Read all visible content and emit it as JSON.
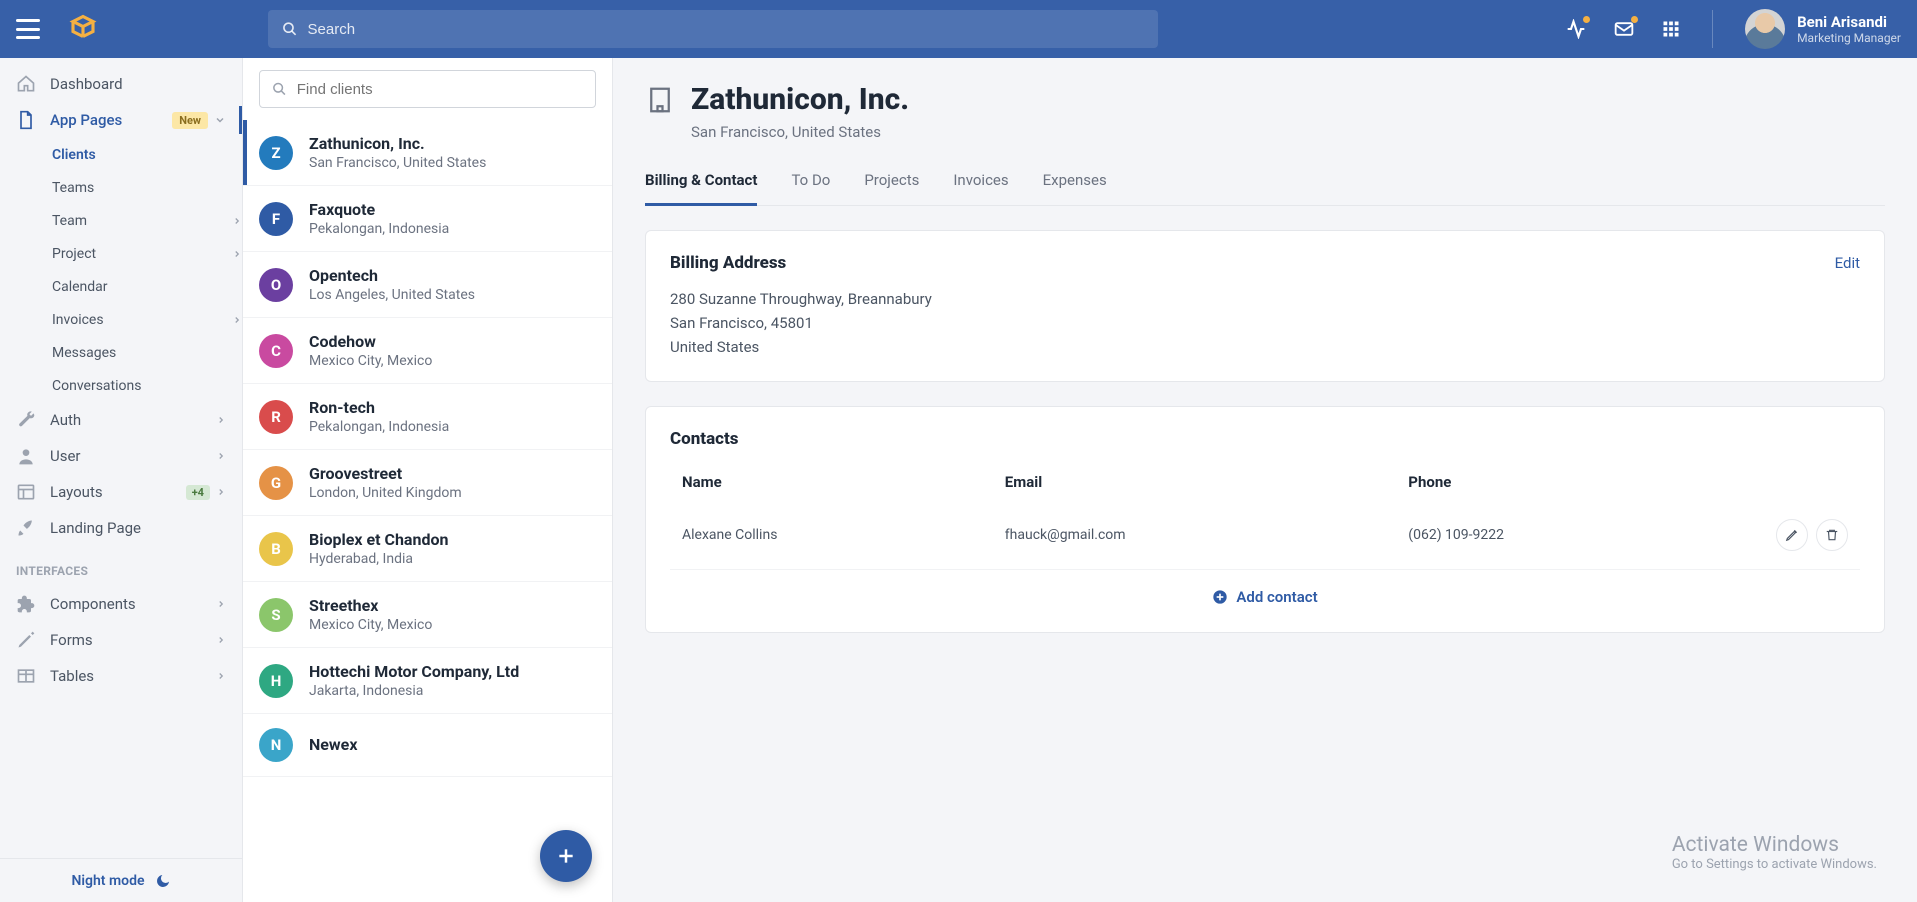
{
  "header": {
    "search_placeholder": "Search",
    "user_name": "Beni Arisandi",
    "user_role": "Marketing Manager"
  },
  "sidebar": {
    "dashboard": "Dashboard",
    "app_pages": "App Pages",
    "app_pages_badge": "New",
    "sub": {
      "clients": "Clients",
      "teams": "Teams",
      "team": "Team",
      "project": "Project",
      "calendar": "Calendar",
      "invoices": "Invoices",
      "messages": "Messages",
      "conversations": "Conversations"
    },
    "auth": "Auth",
    "user": "User",
    "layouts": "Layouts",
    "layouts_badge": "+4",
    "landing": "Landing Page",
    "interfaces_label": "INTERFACES",
    "components": "Components",
    "forms": "Forms",
    "tables": "Tables",
    "footer": "Night mode"
  },
  "clients": {
    "search_placeholder": "Find clients",
    "list": [
      {
        "initial": "Z",
        "name": "Zathunicon, Inc.",
        "loc": "San Francisco, United States",
        "color": "#237bbd",
        "active": true
      },
      {
        "initial": "F",
        "name": "Faxquote",
        "loc": "Pekalongan, Indonesia",
        "color": "#2f5ba5",
        "active": false
      },
      {
        "initial": "O",
        "name": "Opentech",
        "loc": "Los Angeles, United States",
        "color": "#6b3fa0",
        "active": false
      },
      {
        "initial": "C",
        "name": "Codehow",
        "loc": "Mexico City, Mexico",
        "color": "#c94aa0",
        "active": false
      },
      {
        "initial": "R",
        "name": "Ron-tech",
        "loc": "Pekalongan, Indonesia",
        "color": "#d94c4c",
        "active": false
      },
      {
        "initial": "G",
        "name": "Groovestreet",
        "loc": "London, United Kingdom",
        "color": "#e59246",
        "active": false
      },
      {
        "initial": "B",
        "name": "Bioplex et Chandon",
        "loc": "Hyderabad, India",
        "color": "#e9c54a",
        "active": false
      },
      {
        "initial": "S",
        "name": "Streethex",
        "loc": "Mexico City, Mexico",
        "color": "#8bc66b",
        "active": false
      },
      {
        "initial": "H",
        "name": "Hottechi Motor Company, Ltd",
        "loc": "Jakarta, Indonesia",
        "color": "#2ea882",
        "active": false
      },
      {
        "initial": "N",
        "name": "Newex",
        "loc": "",
        "color": "#3aa5c9",
        "active": false
      }
    ]
  },
  "detail": {
    "company_name": "Zathunicon, Inc.",
    "company_loc": "San Francisco, United States",
    "tabs": {
      "billing": "Billing & Contact",
      "todo": "To Do",
      "projects": "Projects",
      "invoices": "Invoices",
      "expenses": "Expenses"
    },
    "billing": {
      "title": "Billing Address",
      "edit": "Edit",
      "line1": "280 Suzanne Throughway, Breannabury",
      "line2": "San Francisco, 45801",
      "line3": "United States"
    },
    "contacts": {
      "title": "Contacts",
      "headers": {
        "name": "Name",
        "email": "Email",
        "phone": "Phone"
      },
      "rows": [
        {
          "name": "Alexane Collins",
          "email": "fhauck@gmail.com",
          "phone": "(062) 109-9222"
        }
      ],
      "add": "Add contact"
    }
  },
  "windows": {
    "t1": "Activate Windows",
    "t2": "Go to Settings to activate Windows."
  }
}
